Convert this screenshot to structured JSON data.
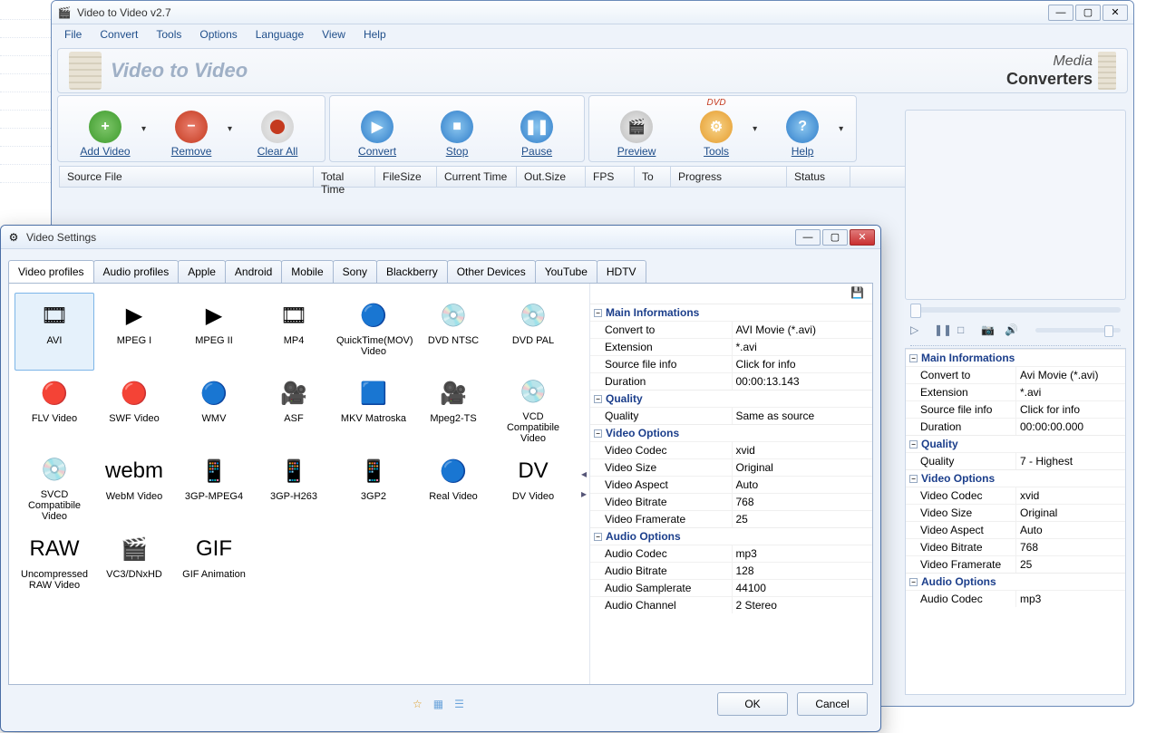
{
  "main": {
    "title": "Video to Video v2.7",
    "menu": [
      "File",
      "Convert",
      "Tools",
      "Options",
      "Language",
      "View",
      "Help"
    ],
    "banner": "Video to Video",
    "logo": {
      "top": "Media",
      "bottom": "Converters"
    },
    "toolbar": [
      {
        "label": "Add Video",
        "icon": "ic-add",
        "glyph": "+",
        "arrow": true
      },
      {
        "label": "Remove",
        "icon": "ic-remove",
        "glyph": "−",
        "arrow": true
      },
      {
        "label": "Clear All",
        "icon": "ic-clear",
        "glyph": ""
      },
      {
        "label": "Convert",
        "icon": "ic-convert",
        "glyph": "▶"
      },
      {
        "label": "Stop",
        "icon": "ic-stop",
        "glyph": "■"
      },
      {
        "label": "Pause",
        "icon": "ic-pause",
        "glyph": "❚❚"
      },
      {
        "label": "Preview",
        "icon": "ic-preview",
        "glyph": "🎬"
      },
      {
        "label": "Tools",
        "icon": "ic-tools",
        "glyph": "⚙",
        "arrow": true,
        "badge": "DVD"
      },
      {
        "label": "Help",
        "icon": "ic-help",
        "glyph": "?",
        "arrow": true
      }
    ],
    "columns": [
      "Source File",
      "Total Time",
      "FileSize",
      "Current Time",
      "Out.Size",
      "FPS",
      "To",
      "Progress",
      "Status"
    ]
  },
  "preview_controls": [
    "▷",
    "❚❚",
    "□",
    "📷",
    "🔊"
  ],
  "info_right": {
    "sections": [
      {
        "title": "Main Informations",
        "rows": [
          [
            "Convert to",
            "Avi Movie (*.avi)"
          ],
          [
            "Extension",
            "*.avi"
          ],
          [
            "Source file info",
            "Click for info"
          ],
          [
            "Duration",
            "00:00:00.000"
          ]
        ]
      },
      {
        "title": "Quality",
        "rows": [
          [
            "Quality",
            "7 - Highest"
          ]
        ]
      },
      {
        "title": "Video Options",
        "rows": [
          [
            "Video Codec",
            "xvid"
          ],
          [
            "Video Size",
            "Original"
          ],
          [
            "Video Aspect",
            "Auto"
          ],
          [
            "Video Bitrate",
            "768"
          ],
          [
            "Video Framerate",
            "25"
          ]
        ]
      },
      {
        "title": "Audio Options",
        "rows": [
          [
            "Audio Codec",
            "mp3"
          ]
        ]
      }
    ]
  },
  "dialog": {
    "title": "Video Settings",
    "tabs": [
      "Video profiles",
      "Audio profiles",
      "Apple",
      "Android",
      "Mobile",
      "Sony",
      "Blackberry",
      "Other Devices",
      "YouTube",
      "HDTV"
    ],
    "active_tab": 0,
    "profiles": [
      "AVI",
      "MPEG I",
      "MPEG II",
      "MP4",
      "QuickTime(MOV) Video",
      "DVD NTSC",
      "DVD PAL",
      "FLV Video",
      "SWF Video",
      "WMV",
      "ASF",
      "MKV Matroska",
      "Mpeg2-TS",
      "VCD Compatibile Video",
      "SVCD Compatibile Video",
      "WebM Video",
      "3GP-MPEG4",
      "3GP-H263",
      "3GP2",
      "Real Video",
      "DV Video",
      "Uncompressed RAW Video",
      "VC3/DNxHD",
      "GIF Animation"
    ],
    "profile_icons": [
      "🎞",
      "▶",
      "▶",
      "🎞",
      "🔵",
      "💿",
      "💿",
      "🔴",
      "🔴",
      "🔵",
      "🎥",
      "🟦",
      "🎥",
      "💿",
      "💿",
      "webm",
      "📱",
      "📱",
      "📱",
      "🔵",
      "DV",
      "RAW",
      "🎬",
      "GIF"
    ],
    "sections": [
      {
        "title": "Main Informations",
        "rows": [
          [
            "Convert to",
            "AVI Movie (*.avi)"
          ],
          [
            "Extension",
            "*.avi"
          ],
          [
            "Source file info",
            "Click for info"
          ],
          [
            "Duration",
            "00:00:13.143"
          ]
        ]
      },
      {
        "title": "Quality",
        "rows": [
          [
            "Quality",
            "Same as source"
          ]
        ]
      },
      {
        "title": "Video Options",
        "rows": [
          [
            "Video Codec",
            "xvid"
          ],
          [
            "Video Size",
            "Original"
          ],
          [
            "Video Aspect",
            "Auto"
          ],
          [
            "Video Bitrate",
            "768"
          ],
          [
            "Video Framerate",
            "25"
          ]
        ]
      },
      {
        "title": "Audio Options",
        "rows": [
          [
            "Audio Codec",
            "mp3"
          ],
          [
            "Audio Bitrate",
            "128"
          ],
          [
            "Audio Samplerate",
            "44100"
          ],
          [
            "Audio Channel",
            "2 Stereo"
          ]
        ]
      }
    ],
    "buttons": {
      "ok": "OK",
      "cancel": "Cancel"
    }
  }
}
